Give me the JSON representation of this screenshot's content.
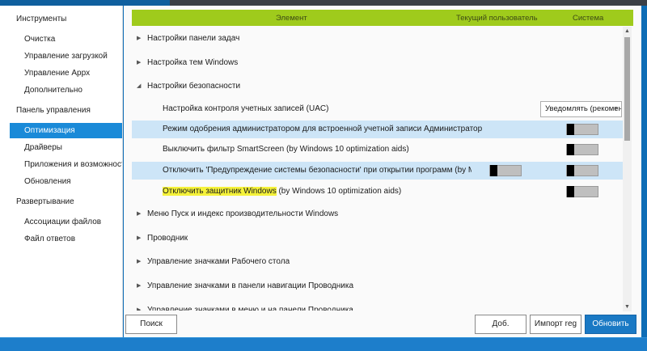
{
  "sidebar": {
    "sections": [
      "Инструменты",
      "Панель управления",
      "Развертывание"
    ],
    "tools": [
      "Очистка",
      "Управление загрузкой",
      "Управление Appx",
      "Дополнительно"
    ],
    "control_panel": [
      "Оптимизация",
      "Драйверы",
      "Приложения и возможности",
      "Обновления"
    ],
    "deployment": [
      "Ассоциации файлов",
      "Файл ответов"
    ],
    "active_item": "Оптимизация"
  },
  "header": {
    "element": "Элемент",
    "current_user": "Текущий пользователь",
    "system": "Система",
    "color": "#9fcb1c"
  },
  "rows": [
    {
      "label": "Настройки панели задач"
    },
    {
      "label": "Настройка тем Windows"
    },
    {
      "label": "Настройки безопасности"
    },
    {
      "label": "Настройка контроля учетных записей (UAC)",
      "dropdown": "Уведомлять (рекомендуется)"
    },
    {
      "label": "Режим одобрения администратором для встроенной учетной записи Администратор"
    },
    {
      "label": "Выключить фильтр SmartScreen (by Windows 10 optimization aids)"
    },
    {
      "label": "Отключить 'Предупреждение системы безопасности' при открытии программ (by Microsoft)"
    },
    {
      "label_marked": "Отключить защитник Windows",
      "label_rest": " (by Windows 10 optimization aids)"
    },
    {
      "label": "Меню Пуск и индекс производительности Windows"
    },
    {
      "label": "Проводник"
    },
    {
      "label": "Управление значками Рабочего стола"
    },
    {
      "label": "Управление значками в панели навигации Проводника"
    },
    {
      "label": "Управление значками в меню и на панели Проводника"
    }
  ],
  "buttons": {
    "search": "Поиск",
    "add_rule": "Доб. правило",
    "import_reg": "Импорт reg",
    "refresh": "Обновить"
  },
  "colors": {
    "accent": "#1a79c4",
    "highlight_row": "#cde5f7",
    "text_marker": "#f5f23a"
  }
}
